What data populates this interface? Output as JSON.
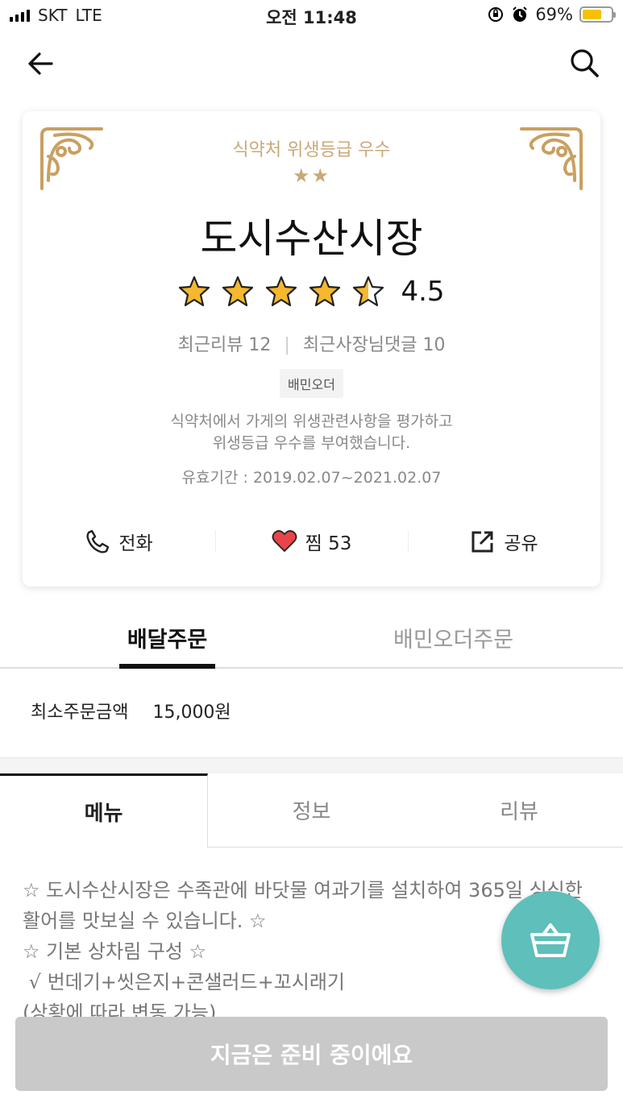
{
  "status_bar": {
    "carrier": "SKT",
    "network": "LTE",
    "time": "오전 11:48",
    "battery_percent": "69%",
    "battery_level": 0.69,
    "battery_color": "#f6c200"
  },
  "nav": {
    "back_icon": "arrow-left-icon",
    "search_icon": "search-icon"
  },
  "store_card": {
    "hygiene_grade": "식약처 위생등급 우수",
    "grade_stars": "★★",
    "store_name": "도시수산시장",
    "rating_value": 4.5,
    "rating_text": "4.5",
    "star_color": "#f5b82e",
    "recent_reviews": "최근리뷰 12",
    "owner_replies": "최근사장님댓글 10",
    "tag": "배민오더",
    "description_line1": "식약처에서 가게의 위생관련사항을 평가하고",
    "description_line2": "위생등급 우수를 부여했습니다.",
    "validity": "유효기간 : 2019.02.07~2021.02.07",
    "actions": {
      "call_label": "전화",
      "favorite_label": "찜 53",
      "share_label": "공유"
    },
    "accent_color": "#c8a97a"
  },
  "order_tabs": {
    "delivery": "배달주문",
    "baemin_order": "배민오더주문"
  },
  "min_order": {
    "label": "최소주문금액",
    "value": "15,000원"
  },
  "menu_tabs": {
    "menu": "메뉴",
    "info": "정보",
    "review": "리뷰"
  },
  "menu_description": "☆ 도시수산시장은 수족관에 바닷물 여과기를 설치하여 365일 싱싱한 활어를 맛보실 수 있습니다. ☆\n☆ 기본 상차림 구성 ☆\n √ 번데기+씻은지+콘샐러드+꼬시래기\n(상황에 따라 변동 가능)",
  "cart": {
    "icon": "basket-icon",
    "color": "#5fbfbb"
  },
  "bottom_button": {
    "label": "지금은 준비 중이에요"
  }
}
